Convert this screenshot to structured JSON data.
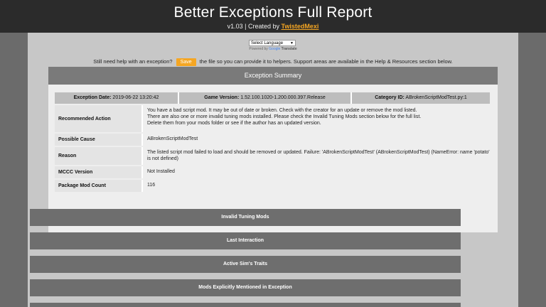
{
  "header": {
    "title": "Better Exceptions Full Report",
    "version_text": "v1.03 | Created by ",
    "author": "TwistedMexi"
  },
  "translate": {
    "select_label": "Select Language",
    "powered_by": "Powered by",
    "google": "Google",
    "translate": "Translate"
  },
  "help": {
    "before": "Still need help with an exception?",
    "save_label": "Save",
    "after": "the file so you can provide it to helpers. Support areas are available in the Help & Resources section below."
  },
  "summary": {
    "title": "Exception Summary",
    "exception_date_label": "Exception Date:",
    "exception_date": "2019-06-22 13:20:42",
    "game_version_label": "Game Version:",
    "game_version": "1.52.100.1020-1.200.000.397.Release",
    "category_id_label": "Category ID:",
    "category_id": "ABrokenScriptModTest.py:1",
    "rows": {
      "recommended_action_label": "Recommended Action",
      "recommended_action_1": "You have a bad script mod. It may be out of date or broken. Check with the creator for an update or remove the mod listed.",
      "recommended_action_2": "There are also one or more invalid tuning mods installed. Please check the Invalid Tuning Mods section below for the full list.",
      "recommended_action_3": "Delete them from your mods folder or see if the author has an updated version.",
      "possible_cause_label": "Possible Cause",
      "possible_cause": "ABrokenScriptModTest",
      "reason_label": "Reason",
      "reason": "The listed script mod failed to load and should be removed or updated. Failure: 'ABrokenScriptModTest' (ABrokenScriptModTest) (NameError: name 'potato' is not defined)",
      "mccc_label": "MCCC Version",
      "mccc": "Not Installed",
      "package_label": "Package Mod Count",
      "package": "116"
    }
  },
  "sections": {
    "invalid_tuning": "Invalid Tuning Mods",
    "last_interaction": "Last Interaction",
    "active_sim_traits": "Active Sim's Traits",
    "mods_mentioned": "Mods Explicitly Mentioned in Exception"
  },
  "colors": {
    "accent": "#f5a623",
    "header_bg": "#2b2b2b",
    "section_bg": "#6e6e6e"
  }
}
